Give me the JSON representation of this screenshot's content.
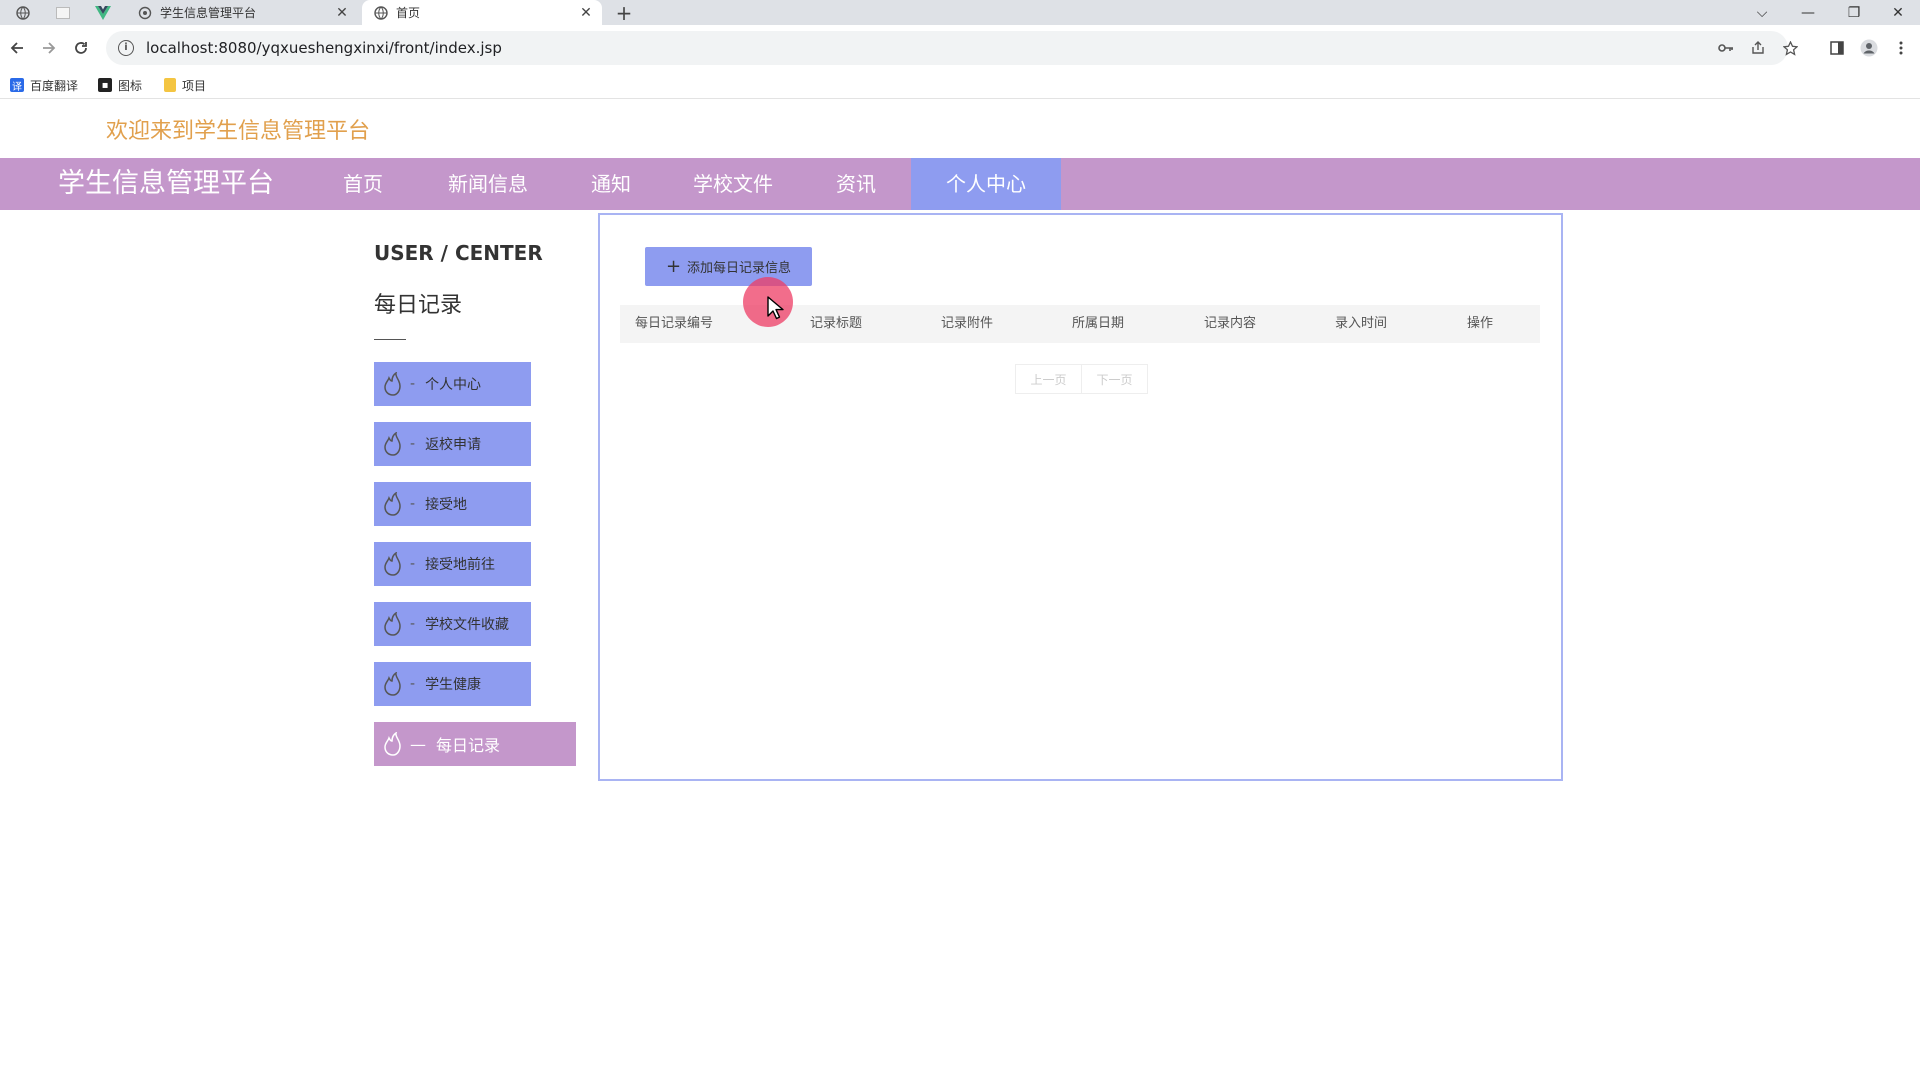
{
  "browser": {
    "tabs": [
      {
        "title": "学生信息管理平台",
        "close": "✕"
      },
      {
        "title": "首页",
        "close": "✕"
      }
    ],
    "new_tab": "+",
    "window_controls": {
      "dropdown": "⌵",
      "minimize": "—",
      "restore": "❐",
      "close": "✕"
    },
    "url": "localhost:8080/yqxueshengxinxi/front/index.jsp",
    "bookmarks": [
      {
        "label": "百度翻译",
        "icon": "translate-icon",
        "color": "#2a6ae8"
      },
      {
        "label": "图标",
        "icon": "image-icon",
        "color": "#222222"
      },
      {
        "label": "项目",
        "icon": "folder-icon",
        "color": "#f4c542"
      }
    ]
  },
  "page": {
    "welcome": "欢迎来到学生信息管理平台",
    "brand": "学生信息管理平台",
    "nav": [
      {
        "label": "首页",
        "active": false
      },
      {
        "label": "新闻信息",
        "active": false
      },
      {
        "label": "通知",
        "active": false
      },
      {
        "label": "学校文件",
        "active": false
      },
      {
        "label": "资讯",
        "active": false
      },
      {
        "label": "个人中心",
        "active": true
      }
    ],
    "user_center": {
      "title_en": "USER / CENTER",
      "title_cn": "每日记录"
    },
    "sidebar": [
      {
        "label": "个人中心",
        "dash": "-",
        "active": false
      },
      {
        "label": "返校申请",
        "dash": "-",
        "active": false
      },
      {
        "label": "接受地",
        "dash": "-",
        "active": false
      },
      {
        "label": "接受地前往",
        "dash": "-",
        "active": false
      },
      {
        "label": "学校文件收藏",
        "dash": "-",
        "active": false
      },
      {
        "label": "学生健康",
        "dash": "-",
        "active": false
      },
      {
        "label": "每日记录",
        "dash": "—",
        "active": true
      }
    ],
    "add_button": {
      "plus": "+",
      "label": "添加每日记录信息"
    },
    "table_headers": [
      "每日记录编号",
      "记录标题",
      "记录附件",
      "所属日期",
      "记录内容",
      "录入时间",
      "操作"
    ],
    "pager": {
      "prev": "上一页",
      "next": "下一页"
    }
  },
  "colors": {
    "nav_bg": "#c497cb",
    "accent": "#8e9cf0",
    "welcome": "#e1a04d",
    "content_border": "#a9b4f3"
  }
}
